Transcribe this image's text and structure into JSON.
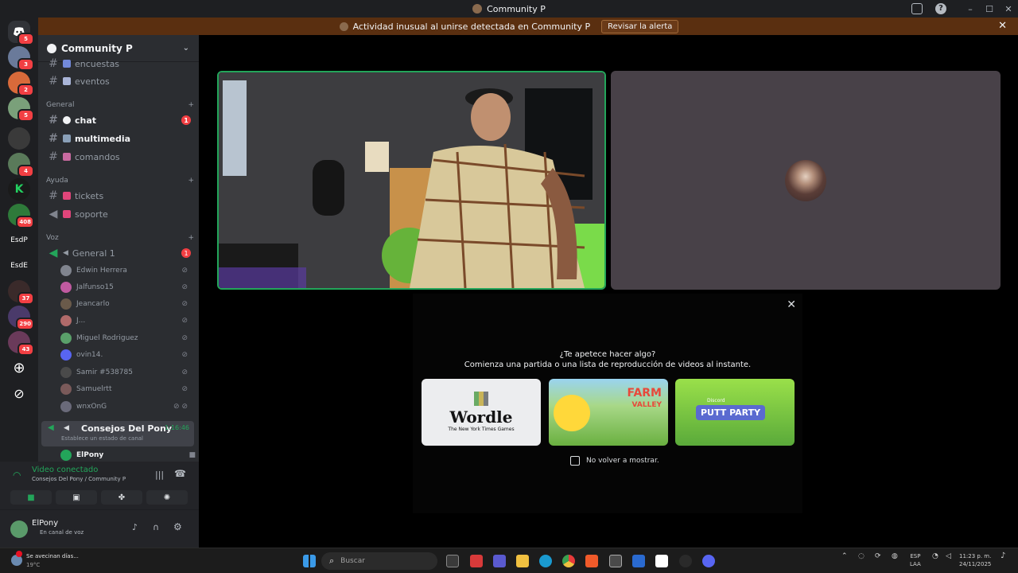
{
  "window": {
    "title": "Community P"
  },
  "alert": {
    "text": "Actividad inusual al unirse detectada en Community P",
    "button": "Revisar la alerta"
  },
  "guild_badges": [
    "5",
    "3",
    "2",
    "5",
    "4",
    "408",
    "37",
    "290",
    "43"
  ],
  "guild_text": {
    "esdp": "EsdP",
    "esde": "EsdE"
  },
  "server": {
    "name": "Community P"
  },
  "channels": {
    "encuestas": "encuestas",
    "eventos": "eventos",
    "cat_general": "General",
    "chat": "chat",
    "chat_count": "1",
    "multimedia": "multimedia",
    "comandos": "comandos",
    "cat_ayuda": "Ayuda",
    "tickets": "tickets",
    "soporte": "soporte",
    "cat_voz": "Voz",
    "general1": "General 1",
    "general1_count": "1",
    "voice_users": [
      "Edwin Herrera",
      "Jalfunso15",
      "Jeancarlo",
      "J...",
      "Miguel Rodriguez",
      "ovin14.",
      "Samir #538785",
      "Samuelrtt",
      "wnxOnG"
    ],
    "consejos": "Consejos Del Pony",
    "consejos_time": "1:16:46",
    "consejos_status": "Establece un estado de canal",
    "elpony_user": "ElPony"
  },
  "voice": {
    "status": "Video conectado",
    "location": "Consejos Del Pony / Community P"
  },
  "user": {
    "name": "ElPony",
    "status": "En canal de voz"
  },
  "activity": {
    "question": "¿Te apetece hacer algo?",
    "subtitle": "Comienza una partida o una lista de reproducción de videos al instante.",
    "games": [
      {
        "title": "Wordle",
        "sub": "The New York Times Games"
      },
      {
        "title": "FARM",
        "sub": "VALLEY"
      },
      {
        "title": "PUTT PARTY",
        "sub": "Discord"
      }
    ],
    "checkbox": "No volver a mostrar."
  },
  "taskbar": {
    "weather": "Se avecinan días...",
    "temp": "19°C",
    "search": "Buscar",
    "lang1": "ESP",
    "lang2": "LAA",
    "time": "11:23 p. m.",
    "date": "24/11/2025"
  },
  "colors": {
    "online": "#23a55a",
    "alert": "#5a2f10",
    "badge": "#f23f43"
  }
}
